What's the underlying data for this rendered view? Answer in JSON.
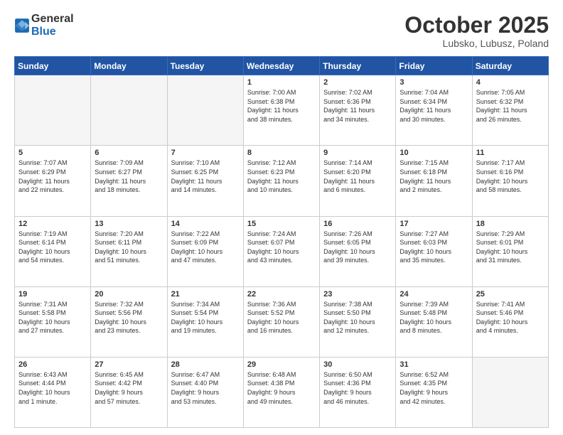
{
  "logo": {
    "general": "General",
    "blue": "Blue"
  },
  "header": {
    "month": "October 2025",
    "location": "Lubsko, Lubusz, Poland"
  },
  "weekdays": [
    "Sunday",
    "Monday",
    "Tuesday",
    "Wednesday",
    "Thursday",
    "Friday",
    "Saturday"
  ],
  "weeks": [
    [
      {
        "day": "",
        "info": ""
      },
      {
        "day": "",
        "info": ""
      },
      {
        "day": "",
        "info": ""
      },
      {
        "day": "1",
        "info": "Sunrise: 7:00 AM\nSunset: 6:38 PM\nDaylight: 11 hours\nand 38 minutes."
      },
      {
        "day": "2",
        "info": "Sunrise: 7:02 AM\nSunset: 6:36 PM\nDaylight: 11 hours\nand 34 minutes."
      },
      {
        "day": "3",
        "info": "Sunrise: 7:04 AM\nSunset: 6:34 PM\nDaylight: 11 hours\nand 30 minutes."
      },
      {
        "day": "4",
        "info": "Sunrise: 7:05 AM\nSunset: 6:32 PM\nDaylight: 11 hours\nand 26 minutes."
      }
    ],
    [
      {
        "day": "5",
        "info": "Sunrise: 7:07 AM\nSunset: 6:29 PM\nDaylight: 11 hours\nand 22 minutes."
      },
      {
        "day": "6",
        "info": "Sunrise: 7:09 AM\nSunset: 6:27 PM\nDaylight: 11 hours\nand 18 minutes."
      },
      {
        "day": "7",
        "info": "Sunrise: 7:10 AM\nSunset: 6:25 PM\nDaylight: 11 hours\nand 14 minutes."
      },
      {
        "day": "8",
        "info": "Sunrise: 7:12 AM\nSunset: 6:23 PM\nDaylight: 11 hours\nand 10 minutes."
      },
      {
        "day": "9",
        "info": "Sunrise: 7:14 AM\nSunset: 6:20 PM\nDaylight: 11 hours\nand 6 minutes."
      },
      {
        "day": "10",
        "info": "Sunrise: 7:15 AM\nSunset: 6:18 PM\nDaylight: 11 hours\nand 2 minutes."
      },
      {
        "day": "11",
        "info": "Sunrise: 7:17 AM\nSunset: 6:16 PM\nDaylight: 10 hours\nand 58 minutes."
      }
    ],
    [
      {
        "day": "12",
        "info": "Sunrise: 7:19 AM\nSunset: 6:14 PM\nDaylight: 10 hours\nand 54 minutes."
      },
      {
        "day": "13",
        "info": "Sunrise: 7:20 AM\nSunset: 6:11 PM\nDaylight: 10 hours\nand 51 minutes."
      },
      {
        "day": "14",
        "info": "Sunrise: 7:22 AM\nSunset: 6:09 PM\nDaylight: 10 hours\nand 47 minutes."
      },
      {
        "day": "15",
        "info": "Sunrise: 7:24 AM\nSunset: 6:07 PM\nDaylight: 10 hours\nand 43 minutes."
      },
      {
        "day": "16",
        "info": "Sunrise: 7:26 AM\nSunset: 6:05 PM\nDaylight: 10 hours\nand 39 minutes."
      },
      {
        "day": "17",
        "info": "Sunrise: 7:27 AM\nSunset: 6:03 PM\nDaylight: 10 hours\nand 35 minutes."
      },
      {
        "day": "18",
        "info": "Sunrise: 7:29 AM\nSunset: 6:01 PM\nDaylight: 10 hours\nand 31 minutes."
      }
    ],
    [
      {
        "day": "19",
        "info": "Sunrise: 7:31 AM\nSunset: 5:58 PM\nDaylight: 10 hours\nand 27 minutes."
      },
      {
        "day": "20",
        "info": "Sunrise: 7:32 AM\nSunset: 5:56 PM\nDaylight: 10 hours\nand 23 minutes."
      },
      {
        "day": "21",
        "info": "Sunrise: 7:34 AM\nSunset: 5:54 PM\nDaylight: 10 hours\nand 19 minutes."
      },
      {
        "day": "22",
        "info": "Sunrise: 7:36 AM\nSunset: 5:52 PM\nDaylight: 10 hours\nand 16 minutes."
      },
      {
        "day": "23",
        "info": "Sunrise: 7:38 AM\nSunset: 5:50 PM\nDaylight: 10 hours\nand 12 minutes."
      },
      {
        "day": "24",
        "info": "Sunrise: 7:39 AM\nSunset: 5:48 PM\nDaylight: 10 hours\nand 8 minutes."
      },
      {
        "day": "25",
        "info": "Sunrise: 7:41 AM\nSunset: 5:46 PM\nDaylight: 10 hours\nand 4 minutes."
      }
    ],
    [
      {
        "day": "26",
        "info": "Sunrise: 6:43 AM\nSunset: 4:44 PM\nDaylight: 10 hours\nand 1 minute."
      },
      {
        "day": "27",
        "info": "Sunrise: 6:45 AM\nSunset: 4:42 PM\nDaylight: 9 hours\nand 57 minutes."
      },
      {
        "day": "28",
        "info": "Sunrise: 6:47 AM\nSunset: 4:40 PM\nDaylight: 9 hours\nand 53 minutes."
      },
      {
        "day": "29",
        "info": "Sunrise: 6:48 AM\nSunset: 4:38 PM\nDaylight: 9 hours\nand 49 minutes."
      },
      {
        "day": "30",
        "info": "Sunrise: 6:50 AM\nSunset: 4:36 PM\nDaylight: 9 hours\nand 46 minutes."
      },
      {
        "day": "31",
        "info": "Sunrise: 6:52 AM\nSunset: 4:35 PM\nDaylight: 9 hours\nand 42 minutes."
      },
      {
        "day": "",
        "info": ""
      }
    ]
  ]
}
